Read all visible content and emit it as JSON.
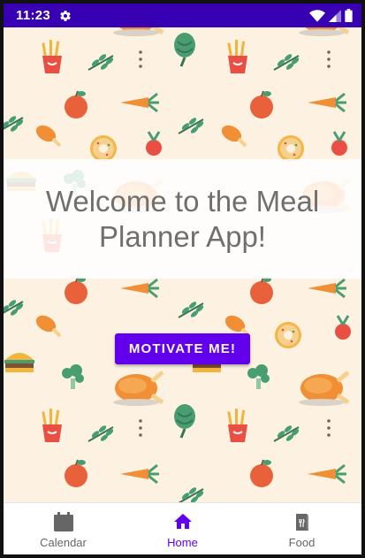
{
  "status_bar": {
    "time": "11:23"
  },
  "main": {
    "welcome": "Welcome to the Meal Planner App!",
    "motivate_button": "MOTIVATE ME!"
  },
  "bottom_nav": {
    "items": [
      {
        "label": "Calendar",
        "icon": "calendar-icon",
        "active": false
      },
      {
        "label": "Home",
        "icon": "home-icon",
        "active": true
      },
      {
        "label": "Food",
        "icon": "food-icon",
        "active": false
      }
    ]
  },
  "colors": {
    "status_bar": "#3700b3",
    "primary": "#6200ee",
    "background_pattern": "#fdf1e2"
  }
}
